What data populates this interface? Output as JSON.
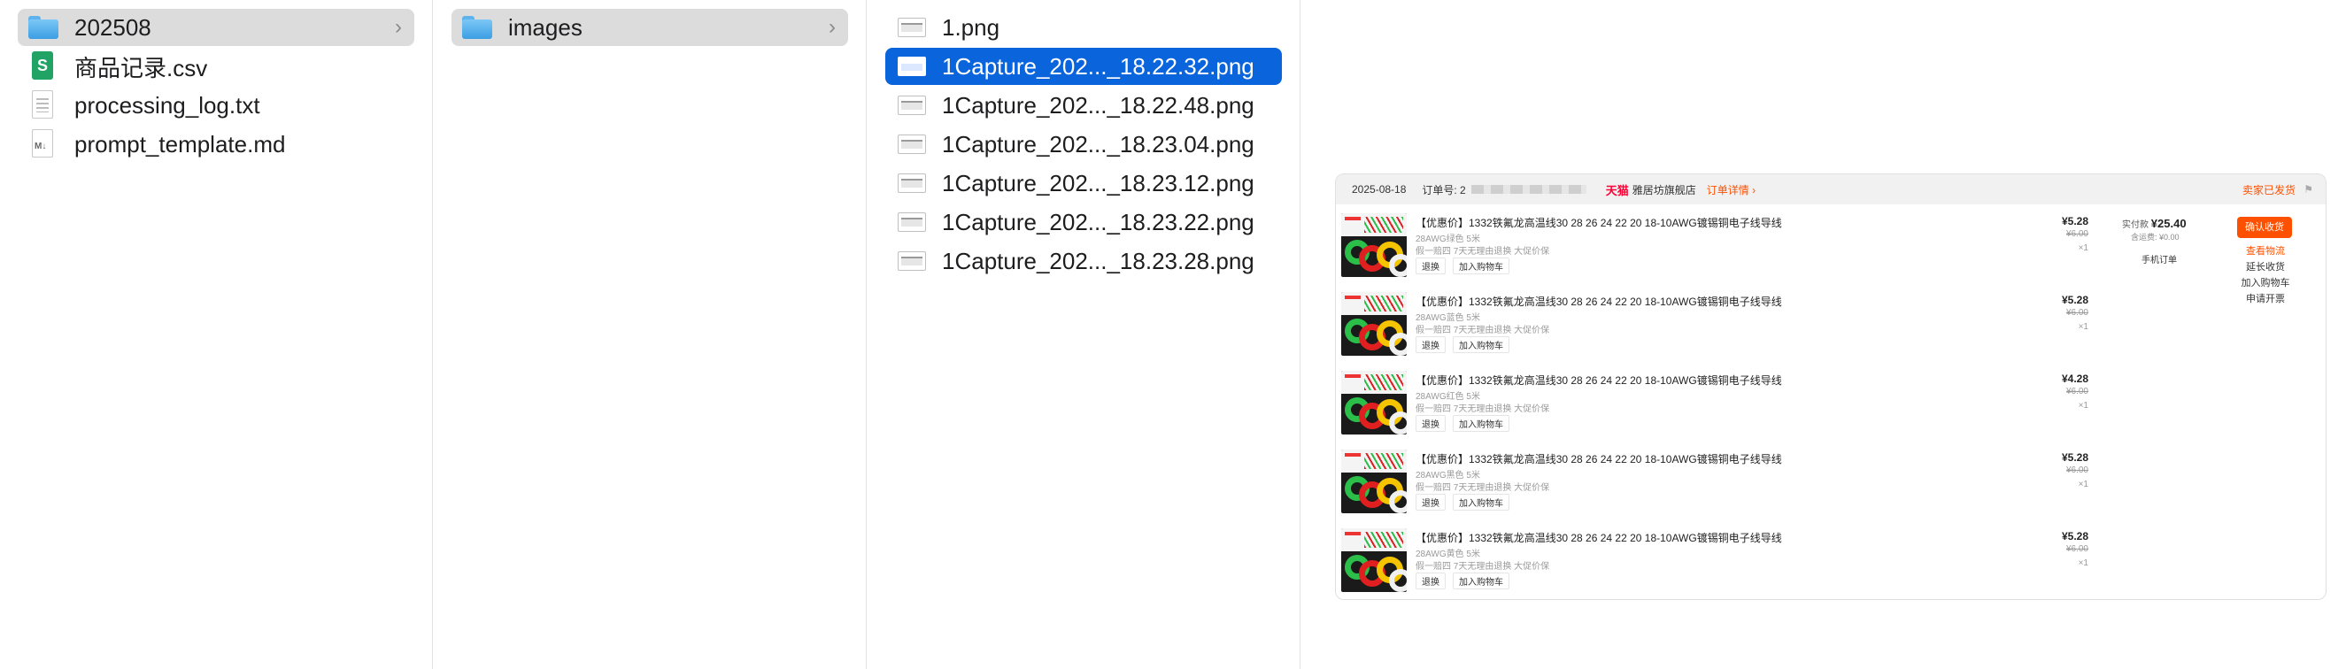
{
  "column1": {
    "items": [
      {
        "label": "202508",
        "icon": "folder-icon",
        "selected": true,
        "chevron": "›"
      },
      {
        "label": "商品记录.csv",
        "icon": "spreadsheet-icon",
        "icon_text": "S"
      },
      {
        "label": "processing_log.txt",
        "icon": "text-document-icon"
      },
      {
        "label": "prompt_template.md",
        "icon": "markdown-document-icon",
        "icon_text": "M↓"
      }
    ]
  },
  "column2": {
    "items": [
      {
        "label": "images",
        "icon": "folder-icon",
        "selected": true,
        "chevron": "›"
      }
    ]
  },
  "column3": {
    "items": [
      {
        "label": "1.png",
        "icon": "image-file-icon"
      },
      {
        "label": "1Capture_202..._18.22.32.png",
        "icon": "image-file-icon",
        "selected": true
      },
      {
        "label": "1Capture_202..._18.22.48.png",
        "icon": "image-file-icon"
      },
      {
        "label": "1Capture_202..._18.23.04.png",
        "icon": "image-file-icon"
      },
      {
        "label": "1Capture_202..._18.23.12.png",
        "icon": "image-file-icon"
      },
      {
        "label": "1Capture_202..._18.23.22.png",
        "icon": "image-file-icon"
      },
      {
        "label": "1Capture_202..._18.23.28.png",
        "icon": "image-file-icon"
      }
    ]
  },
  "preview": {
    "header": {
      "date": "2025-08-18",
      "order_label": "订单号: 2",
      "platform": "天猫",
      "shop": "雅居坊旗舰店",
      "detail_link": "订单详情 ›",
      "status": "卖家已发货",
      "flag": "⚑"
    },
    "items": [
      {
        "title": "【优惠价】1332铁氟龙高温线30 28 26 24 22 20 18-10AWG镀锡铜电子线导线",
        "spec": "28AWG绿色 5米",
        "service": "假一赔四 7天无理由退换 大促价保",
        "btn_return": "退换",
        "btn_cart": "加入购物车",
        "price": "¥5.28",
        "original": "¥6.00",
        "qty": "×1"
      },
      {
        "title": "【优惠价】1332铁氟龙高温线30 28 26 24 22 20 18-10AWG镀锡铜电子线导线",
        "spec": "28AWG蓝色 5米",
        "service": "假一赔四 7天无理由退换 大促价保",
        "btn_return": "退换",
        "btn_cart": "加入购物车",
        "price": "¥5.28",
        "original": "¥6.00",
        "qty": "×1"
      },
      {
        "title": "【优惠价】1332铁氟龙高温线30 28 26 24 22 20 18-10AWG镀锡铜电子线导线",
        "spec": "28AWG红色 5米",
        "service": "假一赔四 7天无理由退换 大促价保",
        "btn_return": "退换",
        "btn_cart": "加入购物车",
        "price": "¥4.28",
        "original": "¥6.00",
        "qty": "×1"
      },
      {
        "title": "【优惠价】1332铁氟龙高温线30 28 26 24 22 20 18-10AWG镀锡铜电子线导线",
        "spec": "28AWG黑色 5米",
        "service": "假一赔四 7天无理由退换 大促价保",
        "btn_return": "退换",
        "btn_cart": "加入购物车",
        "price": "¥5.28",
        "original": "¥6.00",
        "qty": "×1"
      },
      {
        "title": "【优惠价】1332铁氟龙高温线30 28 26 24 22 20 18-10AWG镀锡铜电子线导线",
        "spec": "28AWG黄色 5米",
        "service": "假一赔四 7天无理由退换 大促价保",
        "btn_return": "退换",
        "btn_cart": "加入购物车",
        "price": "¥5.28",
        "original": "¥6.00",
        "qty": "×1"
      }
    ],
    "payment": {
      "paid_label": "实付款",
      "paid_amount": "¥25.40",
      "freight": "含运费: ¥0.00",
      "snapshot": "手机订单"
    },
    "actions": {
      "confirm": "确认收货",
      "logistics": "查看物流",
      "extend": "延长收货",
      "add_cart": "加入购物车",
      "invoice": "申请开票"
    },
    "colors": {
      "accent": "#ff5000",
      "tmall": "#ff0036",
      "selection": "#0a64dc"
    }
  }
}
